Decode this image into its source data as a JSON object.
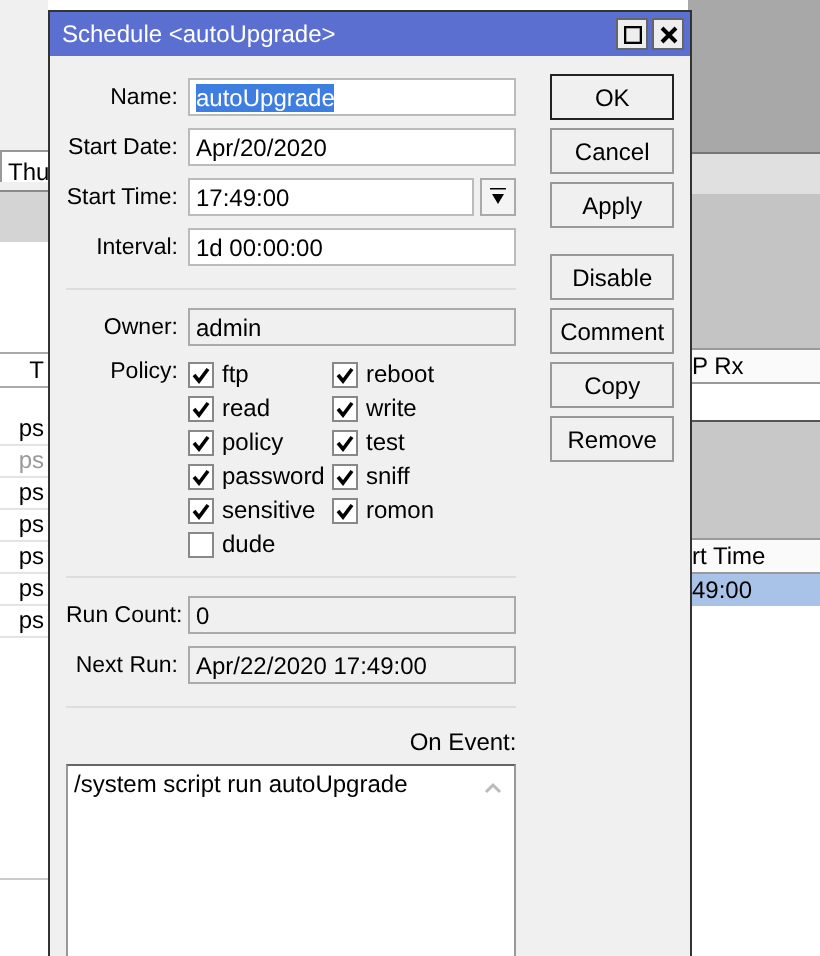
{
  "background": {
    "tab": "Thu",
    "column": "T",
    "rows": [
      {
        "text": "ps",
        "disabled": false
      },
      {
        "text": "ps",
        "disabled": true
      },
      {
        "text": "ps",
        "disabled": false
      },
      {
        "text": "ps",
        "disabled": false
      },
      {
        "text": "ps",
        "disabled": false
      },
      {
        "text": "ps",
        "disabled": false
      },
      {
        "text": "ps",
        "disabled": false
      }
    ],
    "right_header_1": "P Rx",
    "right_header_2": "rt Time",
    "right_rows": [
      {
        "text": "49:00",
        "selected": true
      }
    ]
  },
  "window": {
    "title": "Schedule <autoUpgrade>"
  },
  "fields": [
    {
      "label": "Name:",
      "value": "autoUpgrade",
      "kind": "text",
      "selected": true
    },
    {
      "label": "Start Date:",
      "value": "Apr/20/2020",
      "kind": "text",
      "selected": false
    },
    {
      "label": "Start Time:",
      "value": "17:49:00",
      "kind": "dropdown",
      "selected": false
    },
    {
      "label": "Interval:",
      "value": "1d 00:00:00",
      "kind": "text",
      "selected": false
    }
  ],
  "owner": {
    "label": "Owner:",
    "value": "admin"
  },
  "policy": {
    "label": "Policy:",
    "items": [
      {
        "label": "ftp",
        "checked": true
      },
      {
        "label": "reboot",
        "checked": true
      },
      {
        "label": "read",
        "checked": true
      },
      {
        "label": "write",
        "checked": true
      },
      {
        "label": "policy",
        "checked": true
      },
      {
        "label": "test",
        "checked": true
      },
      {
        "label": "password",
        "checked": true
      },
      {
        "label": "sniff",
        "checked": true
      },
      {
        "label": "sensitive",
        "checked": true
      },
      {
        "label": "romon",
        "checked": true
      },
      {
        "label": "dude",
        "checked": false
      }
    ]
  },
  "run_count": {
    "label": "Run Count:",
    "value": "0"
  },
  "next_run": {
    "label": "Next Run:",
    "value": "Apr/22/2020 17:49:00"
  },
  "on_event": {
    "label": "On Event:",
    "value": "/system script run autoUpgrade"
  },
  "buttons": [
    {
      "label": "OK",
      "default": true
    },
    {
      "label": "Cancel",
      "default": false
    },
    {
      "label": "Apply",
      "default": false
    }
  ],
  "action_buttons": [
    {
      "label": "Disable"
    },
    {
      "label": "Comment"
    },
    {
      "label": "Copy"
    },
    {
      "label": "Remove"
    }
  ]
}
